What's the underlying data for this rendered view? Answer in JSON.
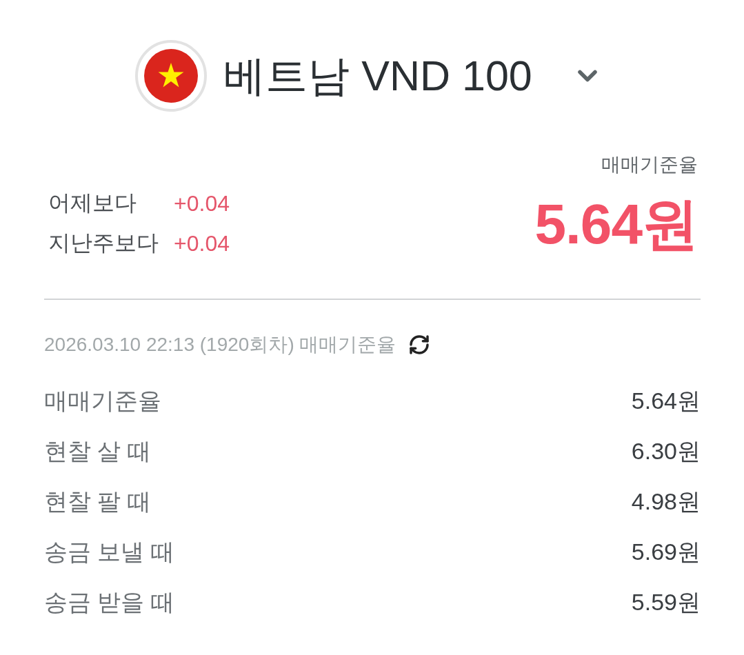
{
  "header": {
    "title": "베트남 VND 100"
  },
  "summary": {
    "label": "매매기준율",
    "rate": "5.64원",
    "changes": [
      {
        "label": "어제보다",
        "value": "+0.04"
      },
      {
        "label": "지난주보다",
        "value": "+0.04"
      }
    ]
  },
  "update_info": {
    "text": "2026.03.10 22:13 (1920회차) 매매기준율"
  },
  "rates": [
    {
      "label": "매매기준율",
      "value": "5.64원"
    },
    {
      "label": "현찰 살 때",
      "value": "6.30원"
    },
    {
      "label": "현찰 팔 때",
      "value": "4.98원"
    },
    {
      "label": "송금 보낼 때",
      "value": "5.69원"
    },
    {
      "label": "송금 받을 때",
      "value": "5.59원"
    }
  ]
}
